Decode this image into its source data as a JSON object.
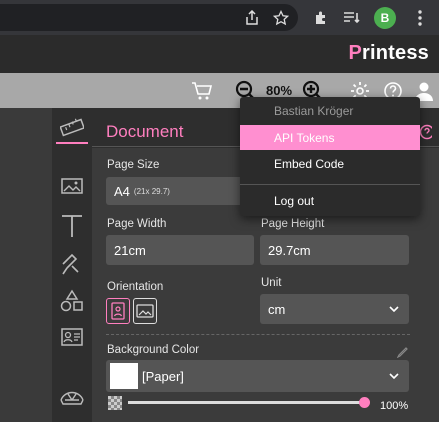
{
  "browser": {
    "profile_initial": "B"
  },
  "brand": {
    "logo_prefix": "P",
    "logo_rest": "rintess"
  },
  "toolbar": {
    "zoom": "80%"
  },
  "panel": {
    "title": "Document",
    "page_size_label": "Page Size",
    "page_size_value": "A4",
    "page_size_dims": "(21x 29.7)",
    "page_width_label": "Page Width",
    "page_width_value": "21cm",
    "page_height_label": "Page Height",
    "page_height_value": "29.7cm",
    "orientation_label": "Orientation",
    "unit_label": "Unit",
    "unit_value": "cm",
    "bg_color_label": "Background Color",
    "bg_color_value": "[Paper]",
    "opacity_value": "100%"
  },
  "menu": {
    "user_name": "Bastian Kröger",
    "items": [
      "API Tokens",
      "Embed Code",
      "Log out"
    ]
  },
  "colors": {
    "accent": "#ff7fbf",
    "menu_highlight": "#ff8fd0"
  }
}
